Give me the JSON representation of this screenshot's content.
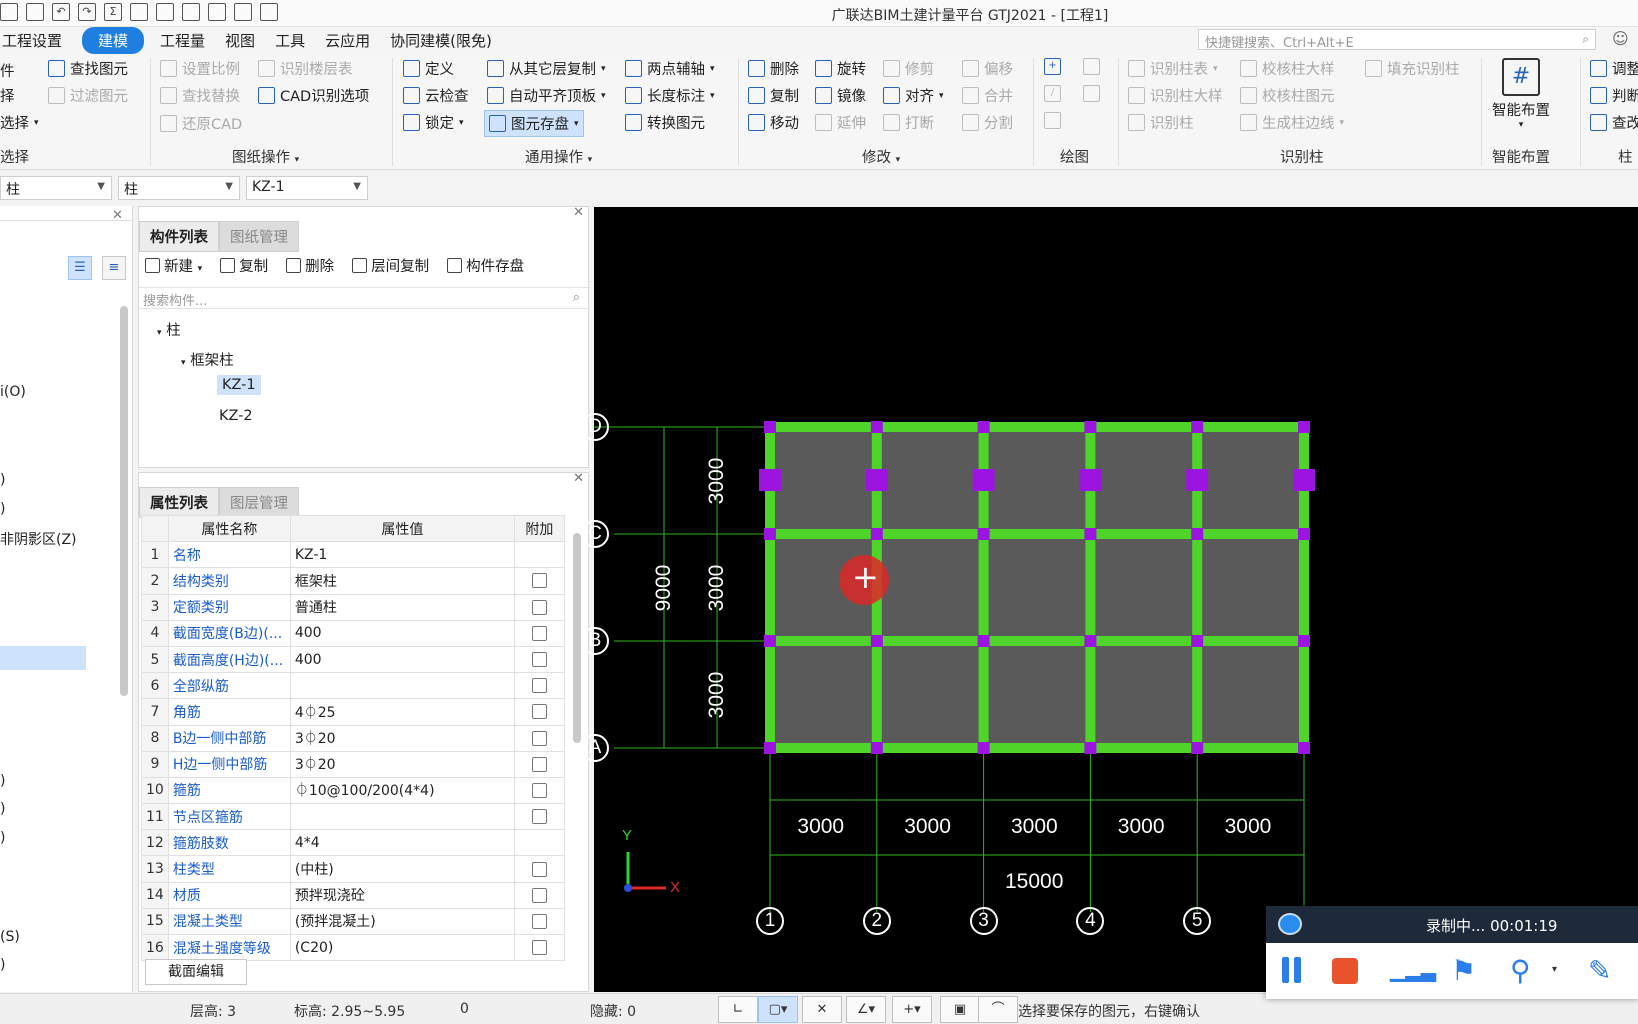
{
  "window": {
    "title": "广联达BIM土建计量平台 GTJ2021 - [工程1]"
  },
  "menus": [
    "工程设置",
    "建模",
    "工程量",
    "视图",
    "工具",
    "云应用",
    "协同建模(限免)"
  ],
  "search": {
    "placeholder": "快捷键搜索、Ctrl+Alt+E"
  },
  "ribbon": {
    "col0": [
      "件",
      "择",
      "选择"
    ],
    "col0_group": "选择",
    "drawing_ops": [
      "查找图元",
      "过滤图元",
      "设置比例",
      "查找替换",
      "还原CAD",
      "识别楼层表",
      "CAD识别选项"
    ],
    "drawing_ops_group": "图纸操作",
    "general_ops": [
      "定义",
      "云检查",
      "锁定",
      "从其它层复制",
      "自动平齐顶板",
      "图元存盘",
      "两点辅轴",
      "长度标注",
      "转换图元"
    ],
    "general_ops_group": "通用操作",
    "modify": [
      "删除",
      "复制",
      "移动",
      "旋转",
      "镜像",
      "延伸",
      "修剪",
      "对齐",
      "打断",
      "偏移",
      "合并",
      "分割"
    ],
    "modify_group": "修改",
    "draw_group": "绘图",
    "recognize": [
      "识别柱表",
      "识别柱大样",
      "识别柱",
      "校核柱大样",
      "校核柱图元",
      "生成柱边线",
      "填充识别柱"
    ],
    "recognize_group": "识别柱",
    "smart": "智能布置",
    "smart_group": "智能布置",
    "col_edge": [
      "调整",
      "判断",
      "查改"
    ],
    "col_edge_group": "柱"
  },
  "selectors": [
    "柱",
    "柱",
    "KZ-1"
  ],
  "leftnav": [
    "i(O)",
    ")",
    ")",
    "非阴影区(Z)",
    ")",
    ")",
    ")",
    "(S)",
    ")"
  ],
  "component_list": {
    "tabs": [
      "构件列表",
      "图纸管理"
    ],
    "toolbar": [
      "新建",
      "复制",
      "删除",
      "层间复制",
      "构件存盘"
    ],
    "search_placeholder": "搜索构件...",
    "tree": {
      "root": "柱",
      "group": "框架柱",
      "items": [
        "KZ-1",
        "KZ-2"
      ]
    }
  },
  "property_list": {
    "tabs": [
      "属性列表",
      "图层管理"
    ],
    "headers": [
      "属性名称",
      "属性值",
      "附加"
    ],
    "rows": [
      {
        "n": "1",
        "name": "名称",
        "value": "KZ-1"
      },
      {
        "n": "2",
        "name": "结构类别",
        "value": "框架柱"
      },
      {
        "n": "3",
        "name": "定额类别",
        "value": "普通柱"
      },
      {
        "n": "4",
        "name": "截面宽度(B边)(...",
        "value": "400"
      },
      {
        "n": "5",
        "name": "截面高度(H边)(...",
        "value": "400"
      },
      {
        "n": "6",
        "name": "全部纵筋",
        "value": ""
      },
      {
        "n": "7",
        "name": "角筋",
        "value": "4⏀25"
      },
      {
        "n": "8",
        "name": "B边一侧中部筋",
        "value": "3⏀20"
      },
      {
        "n": "9",
        "name": "H边一侧中部筋",
        "value": "3⏀20"
      },
      {
        "n": "10",
        "name": "箍筋",
        "value": "⏀10@100/200(4*4)"
      },
      {
        "n": "11",
        "name": "节点区箍筋",
        "value": ""
      },
      {
        "n": "12",
        "name": "箍筋肢数",
        "value": "4*4"
      },
      {
        "n": "13",
        "name": "柱类型",
        "value": "(中柱)"
      },
      {
        "n": "14",
        "name": "材质",
        "value": "预拌现浇砼"
      },
      {
        "n": "15",
        "name": "混凝土类型",
        "value": "(预拌混凝土)"
      },
      {
        "n": "16",
        "name": "混凝土强度等级",
        "value": "(C20)"
      }
    ],
    "section_edit": "截面编辑"
  },
  "canvas": {
    "row_axes": [
      "D",
      "C",
      "B",
      "A"
    ],
    "col_axes": [
      "1",
      "2",
      "3",
      "4",
      "5"
    ],
    "row_spacing": [
      "3000",
      "3000",
      "3000"
    ],
    "row_total": "9000",
    "col_spacing": [
      "3000",
      "3000",
      "3000",
      "3000",
      "3000"
    ],
    "col_total": "15000",
    "axis_x": "X",
    "axis_y": "Y",
    "colors": {
      "beam": "#4fd42a",
      "column": "#9b14e0",
      "slab": "#5a5a5a",
      "dim": "#2fb81e"
    }
  },
  "status": {
    "floor_height": "层高:  3",
    "elevation": "标高:  2.95~5.95",
    "zero": "0",
    "hidden": "隐藏:  0",
    "hint": "选择要保存的图元，右键确认"
  },
  "recorder": {
    "text": "录制中... 00:01:19"
  }
}
